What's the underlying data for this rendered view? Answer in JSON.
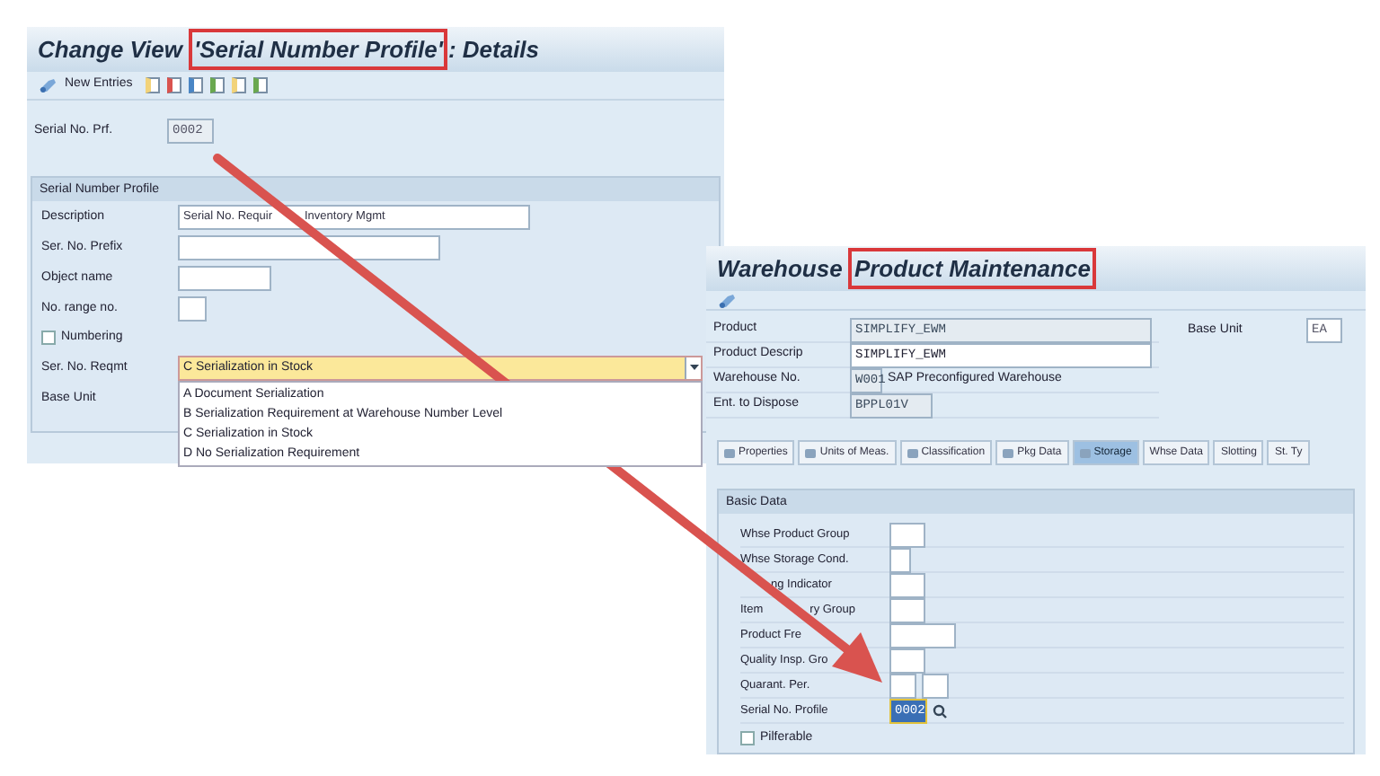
{
  "left_window": {
    "title": {
      "before": "Change View ",
      "highlighted": "'Serial Number Profile'",
      "after": ": Details"
    },
    "toolbar": {
      "label": "New Entries"
    },
    "key_field": {
      "label": "Serial No. Prf.",
      "value": "0002"
    },
    "group": {
      "title": "Serial Number Profile",
      "rows": [
        {
          "kind": "field",
          "label": "Description",
          "value": [
            "Serial No. Requir",
            "Inventory Mgmt"
          ]
        },
        {
          "kind": "field",
          "label": "Ser. No. Prefix",
          "value": ""
        },
        {
          "kind": "field",
          "label": "Object name",
          "value": ""
        },
        {
          "kind": "field",
          "label": "No. range no.",
          "value": ""
        },
        {
          "kind": "checkbox",
          "label": "Numbering",
          "checked": false
        },
        {
          "kind": "dropdown",
          "label": "Ser. No. Reqmt",
          "value": "C Serialization in Stock",
          "expanded": true,
          "options": [
            "A Document Serialization",
            "B Serialization Requirement at Warehouse Number Level",
            "C Serialization in Stock",
            "D No Serialization Requirement"
          ]
        },
        {
          "kind": "label",
          "label": "Base Unit"
        }
      ]
    }
  },
  "right_window": {
    "title": {
      "before": "Warehouse ",
      "highlighted": "Product Maintenance"
    },
    "header_fields": [
      {
        "label": "Product",
        "value": "SIMPLIFY_EWM",
        "readonly": true
      },
      {
        "label": "Product Descrip",
        "value": "SIMPLIFY_EWM",
        "readonly": false
      },
      {
        "label": "Warehouse No.",
        "value": "W001",
        "readonly": true,
        "description": "SAP Preconfigured Warehouse"
      },
      {
        "label": "Ent. to Dispose",
        "value": "BPPL01V",
        "readonly": true
      }
    ],
    "base_unit": {
      "label": "Base Unit",
      "value": "EA"
    },
    "tabs": [
      {
        "label": "Properties",
        "icon": true,
        "selected": false
      },
      {
        "label": "Units of Meas.",
        "icon": true,
        "selected": false
      },
      {
        "label": "Classification",
        "icon": true,
        "selected": false
      },
      {
        "label": "Pkg Data",
        "icon": true,
        "selected": false
      },
      {
        "label": "Storage",
        "icon": true,
        "selected": true
      },
      {
        "label": "Whse Data",
        "icon": false,
        "selected": false
      },
      {
        "label": "Slotting",
        "icon": false,
        "selected": false
      },
      {
        "label": "St. Ty",
        "icon": false,
        "selected": false
      }
    ],
    "section": {
      "title": "Basic Data",
      "rows": [
        {
          "kind": "field",
          "label": [
            "Whse Product Group"
          ],
          "value": ""
        },
        {
          "kind": "field",
          "label": [
            "Whse Storage Cond."
          ],
          "value": ""
        },
        {
          "kind": "field",
          "label": [
            "ng Indicator"
          ],
          "value": ""
        },
        {
          "kind": "field",
          "label": [
            "Item",
            "ry Group"
          ],
          "value": ""
        },
        {
          "kind": "field",
          "label": [
            "Product Fre"
          ],
          "value": ""
        },
        {
          "kind": "field",
          "label": [
            "Quality Insp. Gro"
          ],
          "value": ""
        },
        {
          "kind": "double",
          "label": [
            "Quarant. Per."
          ],
          "value": ""
        },
        {
          "kind": "lookup",
          "label": [
            "Serial No. Profile"
          ],
          "value": "0002",
          "focused": true
        },
        {
          "kind": "checkbox",
          "label": "Pilferable",
          "checked": false
        }
      ]
    }
  }
}
